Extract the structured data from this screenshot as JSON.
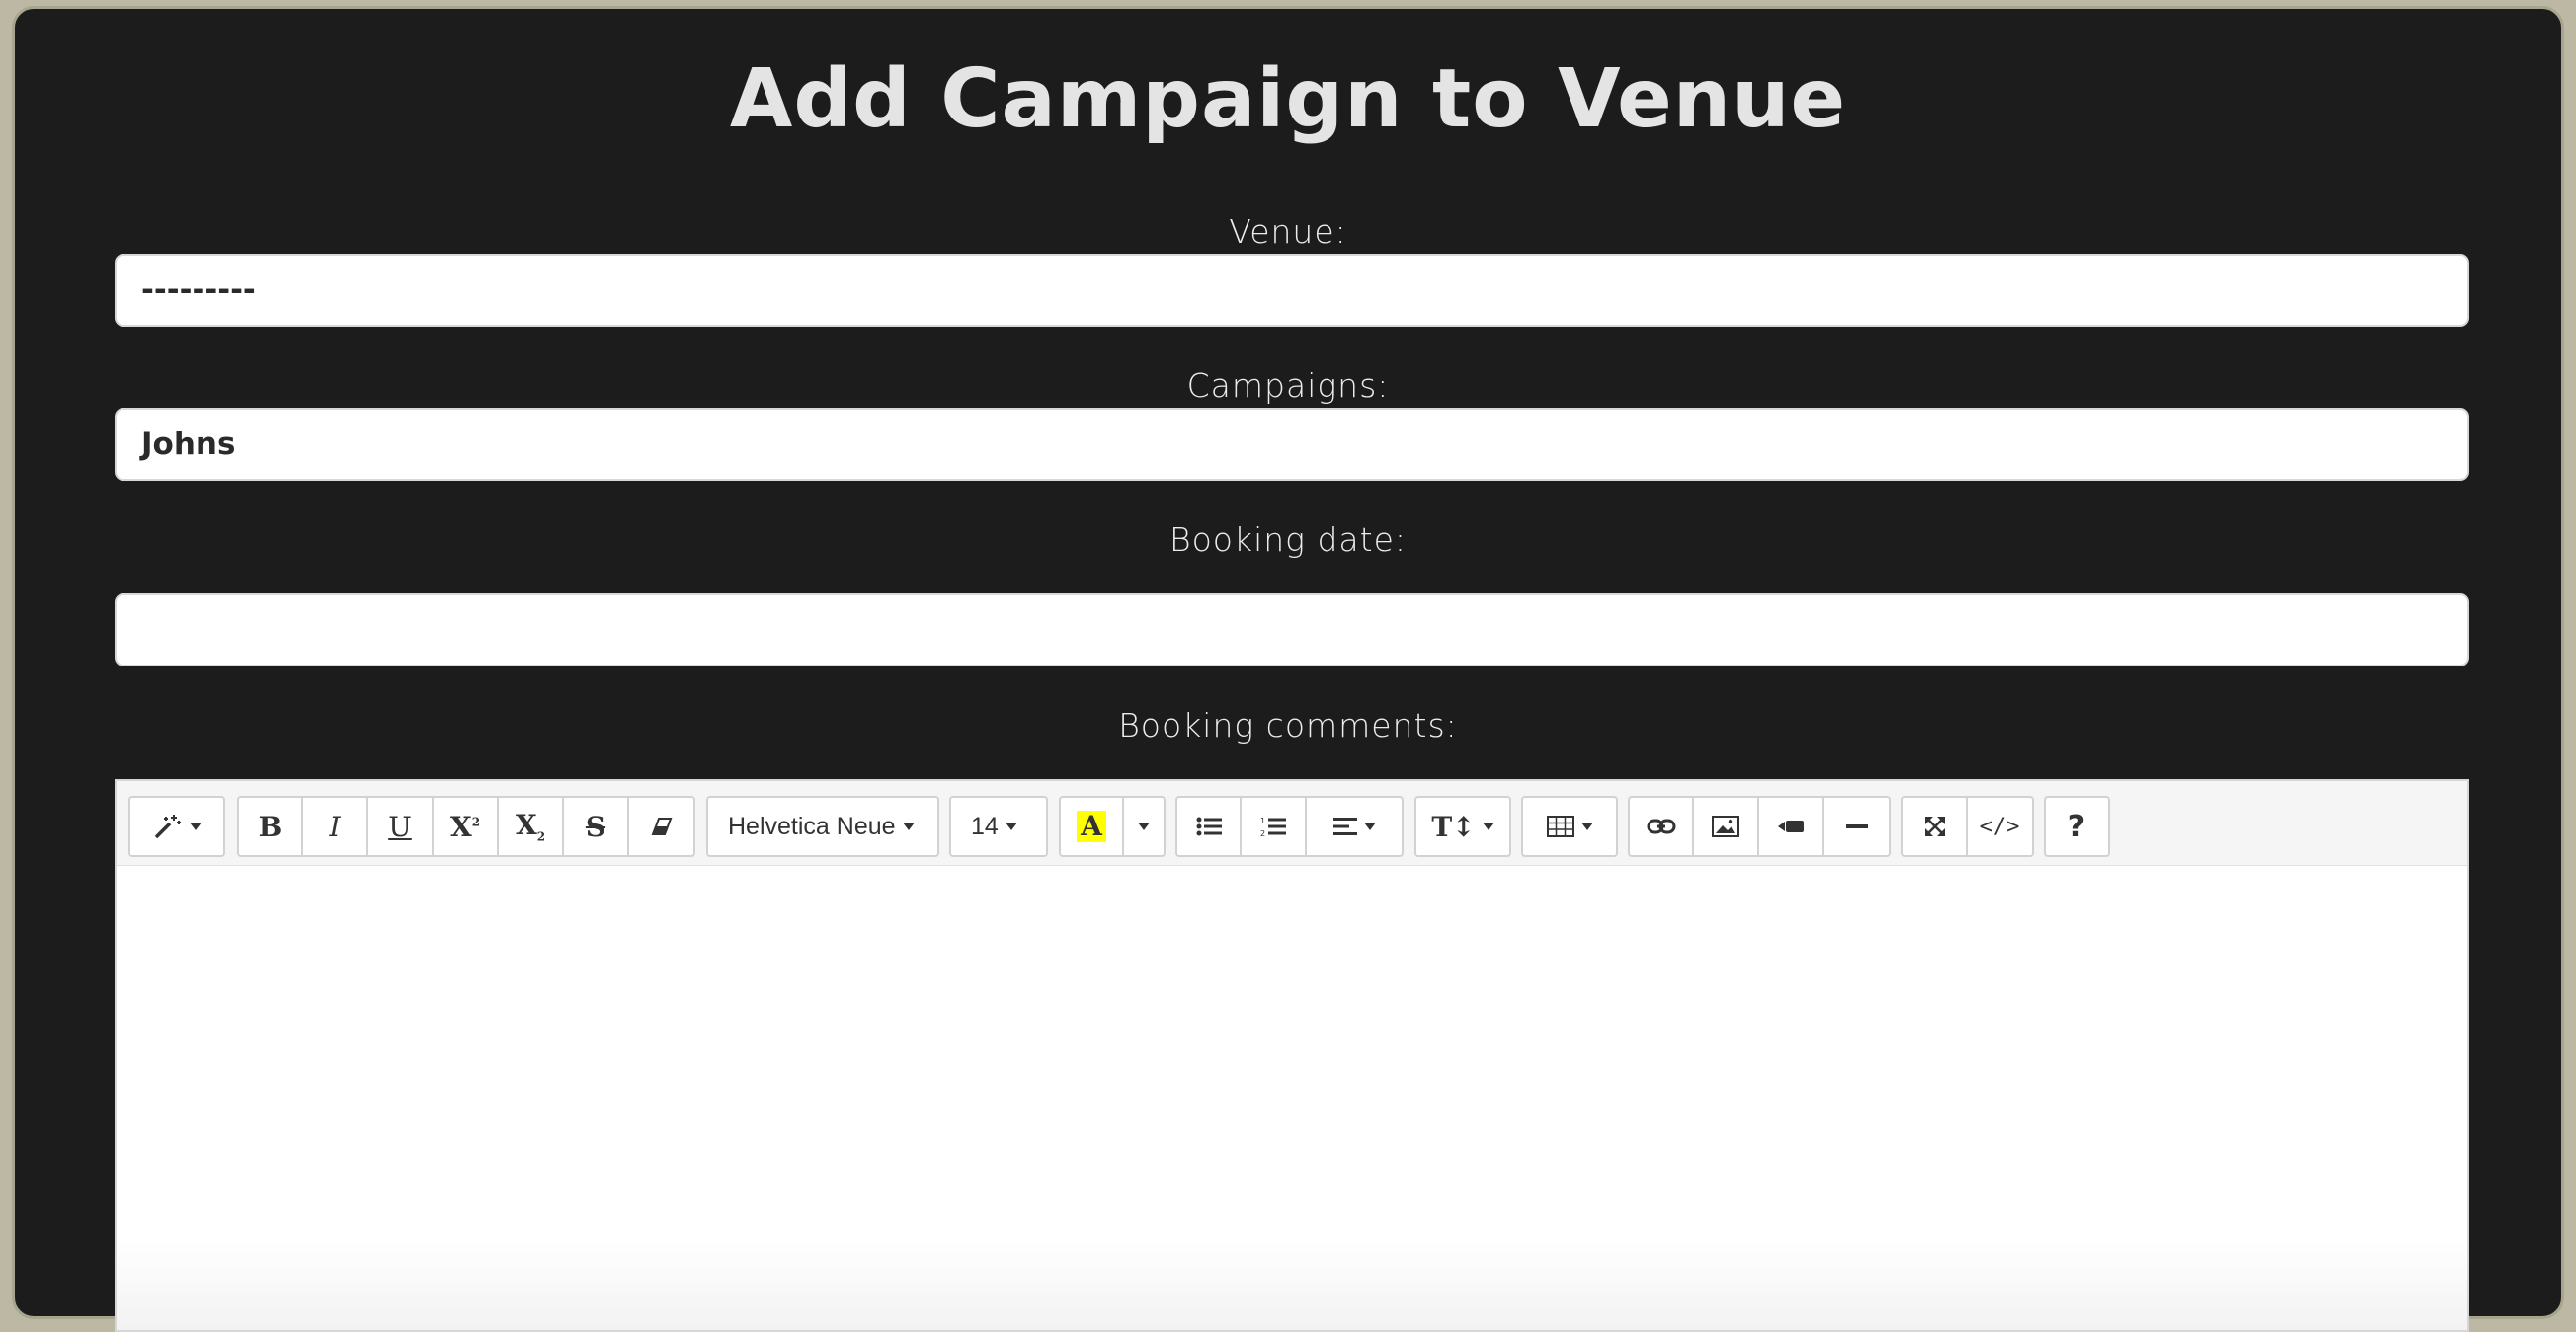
{
  "page": {
    "title": "Add Campaign to Venue"
  },
  "form": {
    "venue": {
      "label": "Venue:",
      "value": "---------"
    },
    "campaigns": {
      "label": "Campaigns:",
      "value": "Johns"
    },
    "booking_date": {
      "label": "Booking date:",
      "value": ""
    },
    "booking_comments": {
      "label": "Booking comments:"
    }
  },
  "editor": {
    "font_family": "Helvetica Neue",
    "font_size": "14",
    "highlight_color": "#ffff00",
    "toolbar_icons": [
      "magic-style-icon",
      "bold-icon",
      "italic-icon",
      "underline-icon",
      "superscript-icon",
      "subscript-icon",
      "strikethrough-icon",
      "eraser-icon",
      "font-family-dropdown",
      "font-size-dropdown",
      "text-color-icon",
      "unordered-list-icon",
      "ordered-list-icon",
      "align-icon",
      "line-height-icon",
      "table-icon",
      "link-icon",
      "picture-icon",
      "video-icon",
      "hr-icon",
      "fullscreen-icon",
      "code-view-icon",
      "help-icon"
    ]
  }
}
